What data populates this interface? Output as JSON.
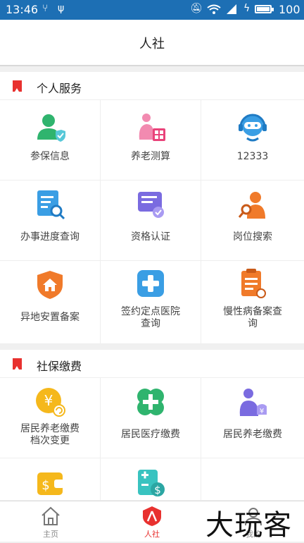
{
  "status_bar": {
    "time": "13:46",
    "left_icons": [
      "usb-tree-icon",
      "usb-icon"
    ],
    "right_icons": [
      "bell-muted-icon",
      "wifi-icon",
      "signal-icon",
      "charging-icon",
      "battery-icon"
    ],
    "battery_level": "100",
    "battery_fraction": 1.0,
    "bg_color": "#1d6fb4"
  },
  "header": {
    "title": "人社"
  },
  "sections": [
    {
      "title": "个人服务",
      "items": [
        {
          "label": "参保信息",
          "icon": "user-shield-icon"
        },
        {
          "label": "养老测算",
          "icon": "elder-calculator-icon"
        },
        {
          "label": "12333",
          "icon": "customer-service-bot-icon"
        },
        {
          "label": "办事进度查询",
          "icon": "document-search-icon"
        },
        {
          "label": "资格认证",
          "icon": "certificate-check-icon"
        },
        {
          "label": "岗位搜索",
          "icon": "job-search-icon"
        },
        {
          "label": "异地安置备案",
          "icon": "house-shield-icon"
        },
        {
          "label": "签约定点医院查询",
          "label_lines": [
            "签约定点医院",
            "查询"
          ],
          "icon": "hospital-cross-icon"
        },
        {
          "label": "慢性病备案查询",
          "label_lines": [
            "慢性病备案查",
            "询"
          ],
          "icon": "clipboard-record-icon"
        }
      ]
    },
    {
      "title": "社保缴费",
      "items": [
        {
          "label": "居民养老缴费档次变更",
          "label_lines": [
            "居民养老缴费",
            "档次变更"
          ],
          "icon": "yuan-coin-change-icon"
        },
        {
          "label": "居民医疗缴费",
          "icon": "medical-clover-icon"
        },
        {
          "label": "居民养老缴费",
          "icon": "elder-payment-icon"
        },
        {
          "label": "",
          "icon": "wallet-dollar-icon"
        },
        {
          "label": "",
          "icon": "calculator-dollar-icon"
        }
      ]
    }
  ],
  "tab_bar": {
    "tabs": [
      {
        "label": "主页",
        "icon": "home-icon",
        "active": false
      },
      {
        "label": "人社",
        "icon": "renshe-logo-icon",
        "active": true
      },
      {
        "label": "我的",
        "icon": "profile-icon",
        "active": false
      }
    ]
  },
  "watermark": {
    "text": "大玩客"
  },
  "colors": {
    "accent_red": "#e8312f",
    "green": "#2fb46e",
    "blue": "#3a9ee4",
    "orange": "#f07a2a",
    "purple": "#7a6be0",
    "yellow": "#f5b81c"
  }
}
